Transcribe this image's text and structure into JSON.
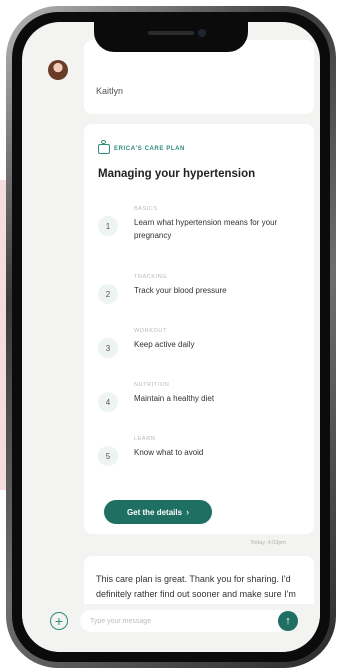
{
  "chat": {
    "sender_name": "Kaitlyn",
    "timestamp": "Today, 4:03pm",
    "reply_text": "This care plan is great. Thank you for sharing. I'd definitely rather find out sooner and make sure I'm taking the"
  },
  "care_plan": {
    "badge": "ERICA'S CARE PLAN",
    "title": "Managing your hypertension",
    "steps": [
      {
        "number": "1",
        "category": "BASICS",
        "text": "Learn what hypertension means for your pregnancy"
      },
      {
        "number": "2",
        "category": "TRACKING",
        "text": "Track your blood pressure"
      },
      {
        "number": "3",
        "category": "WORKOUT",
        "text": "Keep active daily"
      },
      {
        "number": "4",
        "category": "NUTRITION",
        "text": "Maintain a healthy diet"
      },
      {
        "number": "5",
        "category": "LEARN",
        "text": "Know what to avoid"
      }
    ],
    "button_label": "Get the details",
    "button_chevron": "›"
  },
  "composer": {
    "placeholder": "Type your message",
    "add_icon": "+",
    "send_icon": "↑"
  },
  "colors": {
    "accent": "#2e8b7a",
    "button": "#1f6f62",
    "screen_bg": "#f3f3f1"
  }
}
